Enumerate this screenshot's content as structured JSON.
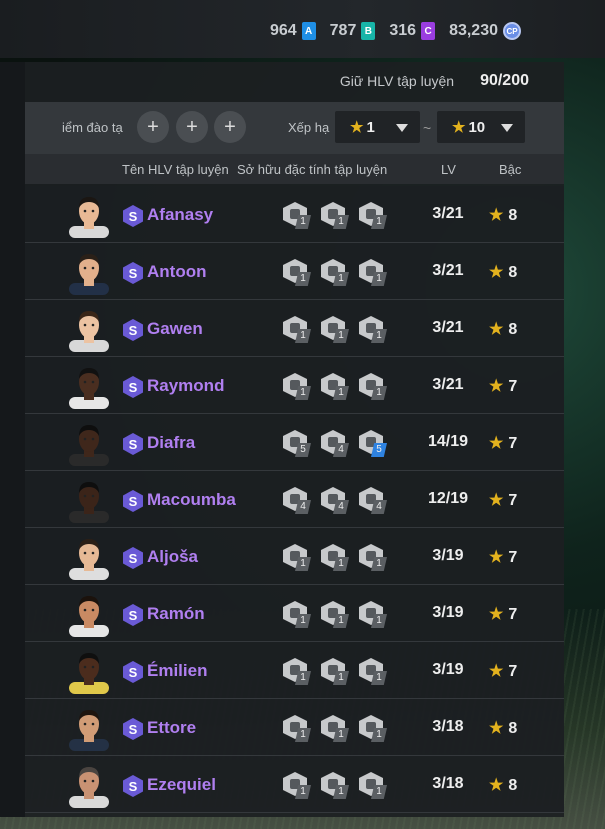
{
  "currencies": [
    {
      "value": "964",
      "chip": "A",
      "color": "#1f8fe6"
    },
    {
      "value": "787",
      "chip": "B",
      "color": "#18b5a8"
    },
    {
      "value": "316",
      "chip": "C",
      "color": "#9a3de0"
    },
    {
      "value": "83,230",
      "chip": "CP",
      "color": "#6a8ee6"
    }
  ],
  "coach_hold": {
    "label": "Giữ HLV tập luyện",
    "value": "90/200"
  },
  "filter": {
    "points_label": "iểm đào tạ",
    "rank_label": "Xếp hạ",
    "rank_min": "1",
    "rank_max": "10",
    "separator": "~"
  },
  "columns": {
    "name": "Tên HLV tập luyện",
    "traits": "Sở hữu đặc tính tập luyện",
    "lv": "LV",
    "grade": "Bậc"
  },
  "coaches": [
    {
      "name": "Afanasy",
      "lv": "3/21",
      "grade": "8",
      "traits": [
        "1",
        "1",
        "1"
      ],
      "skin": "#e8b995",
      "hair": "#1b1612",
      "shirt": "#d8d8d8"
    },
    {
      "name": "Antoon",
      "lv": "3/21",
      "grade": "8",
      "traits": [
        "1",
        "1",
        "1"
      ],
      "skin": "#e2b08c",
      "hair": "#2a2018",
      "shirt": "#223047"
    },
    {
      "name": "Gawen",
      "lv": "3/21",
      "grade": "8",
      "traits": [
        "1",
        "1",
        "1"
      ],
      "skin": "#ecc3a2",
      "hair": "#3a2618",
      "shirt": "#d8d8d8"
    },
    {
      "name": "Raymond",
      "lv": "3/21",
      "grade": "7",
      "traits": [
        "1",
        "1",
        "1"
      ],
      "skin": "#4a2e20",
      "hair": "#111",
      "shirt": "#e6e6e6"
    },
    {
      "name": "Diafra",
      "lv": "14/19",
      "grade": "7",
      "traits": [
        "5",
        "4",
        "5"
      ],
      "skin": "#3f271b",
      "hair": "#0e0e0e",
      "shirt": "#2a2a2a"
    },
    {
      "name": "Macoumba",
      "lv": "12/19",
      "grade": "7",
      "traits": [
        "4",
        "4",
        "4"
      ],
      "skin": "#3b2419",
      "hair": "#0e0e0e",
      "shirt": "#2a2a2a"
    },
    {
      "name": "Aljoša",
      "lv": "3/19",
      "grade": "7",
      "traits": [
        "1",
        "1",
        "1"
      ],
      "skin": "#e6b995",
      "hair": "#2b1f16",
      "shirt": "#dedede"
    },
    {
      "name": "Ramón",
      "lv": "3/19",
      "grade": "7",
      "traits": [
        "1",
        "1",
        "1"
      ],
      "skin": "#c98a63",
      "hair": "#1b120c",
      "shirt": "#e6e6e6"
    },
    {
      "name": "Émilien",
      "lv": "3/19",
      "grade": "7",
      "traits": [
        "1",
        "1",
        "1"
      ],
      "skin": "#4b2c1d",
      "hair": "#0f0f0f",
      "shirt": "#e0c84a"
    },
    {
      "name": "Ettore",
      "lv": "3/18",
      "grade": "8",
      "traits": [
        "1",
        "1",
        "1"
      ],
      "skin": "#d19c76",
      "hair": "#1f150f",
      "shirt": "#243145"
    },
    {
      "name": "Ezequiel",
      "lv": "3/18",
      "grade": "8",
      "traits": [
        "1",
        "1",
        "1"
      ],
      "skin": "#c99273",
      "hair": "#4a4440",
      "shirt": "#d9d9d9"
    }
  ],
  "icons": {
    "plus": "plus-icon",
    "star": "star-icon",
    "caret": "caret-down-icon",
    "trait": "trait-icon",
    "tier": "s-tier-badge"
  }
}
